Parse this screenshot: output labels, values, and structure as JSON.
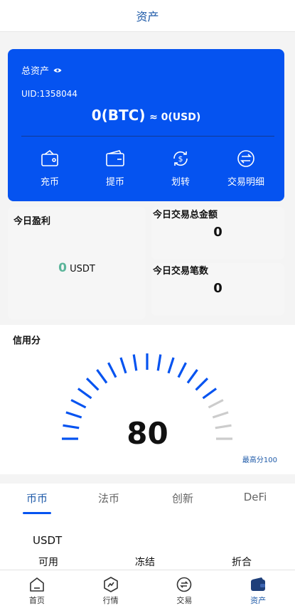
{
  "header": {
    "title": "资产"
  },
  "asset_card": {
    "label": "总资产",
    "uid": "UID:1358044",
    "btc_amount": "0(BTC)",
    "usd_amount": "≈ 0(USD)",
    "actions": [
      {
        "label": "充币",
        "icon": "deposit-icon"
      },
      {
        "label": "提币",
        "icon": "withdraw-icon"
      },
      {
        "label": "划转",
        "icon": "transfer-icon"
      },
      {
        "label": "交易明细",
        "icon": "transaction-detail-icon"
      }
    ]
  },
  "profit": {
    "title": "今日盈利",
    "value": "0",
    "unit": "USDT"
  },
  "stats": [
    {
      "title": "今日交易总金额",
      "value": "0"
    },
    {
      "title": "今日交易笔数",
      "value": "0"
    }
  ],
  "credit": {
    "title": "信用分",
    "score": "80",
    "score_value": 80,
    "max_label": "最高分100",
    "max_value": 100,
    "active_color": "#0553f0",
    "inactive_color": "#cccccc"
  },
  "tabs": [
    {
      "label": "币币",
      "active": true
    },
    {
      "label": "法币",
      "active": false
    },
    {
      "label": "创新",
      "active": false
    },
    {
      "label": "DeFi",
      "active": false
    }
  ],
  "wallet": {
    "coin": "USDT",
    "columns": [
      "可用",
      "冻结",
      "折合"
    ]
  },
  "bottom_nav": [
    {
      "label": "首页",
      "icon": "home-icon",
      "active": false
    },
    {
      "label": "行情",
      "icon": "market-icon",
      "active": false
    },
    {
      "label": "交易",
      "icon": "trade-icon",
      "active": false
    },
    {
      "label": "资产",
      "icon": "wallet-icon",
      "active": true
    }
  ],
  "colors": {
    "primary": "#0553f0",
    "accent_text": "#1e5aa8",
    "profit_green": "#5bb59a"
  }
}
